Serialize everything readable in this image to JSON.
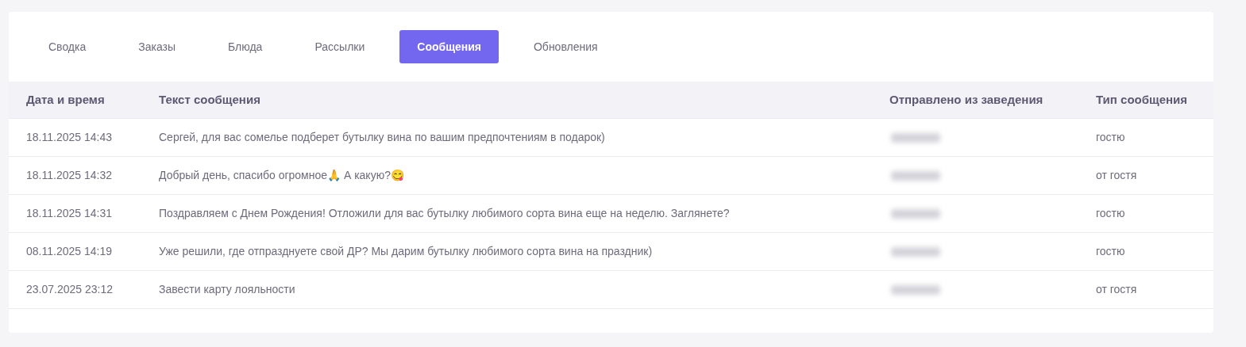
{
  "tabs": [
    {
      "label": "Сводка",
      "selected": false
    },
    {
      "label": "Заказы",
      "selected": false
    },
    {
      "label": "Блюда",
      "selected": false
    },
    {
      "label": "Рассылки",
      "selected": false
    },
    {
      "label": "Сообщения",
      "selected": true
    },
    {
      "label": "Обновления",
      "selected": false
    }
  ],
  "table": {
    "columns": [
      "Дата и время",
      "Текст сообщения",
      "Отправлено из заведения",
      "Тип сообщения"
    ],
    "rows": [
      {
        "date": "18.11.2025 14:43",
        "text": "Сергей, для вас сомелье подберет бутылку вина по вашим предпочтениям в подарок)",
        "venue_redacted": true,
        "type": "гостю"
      },
      {
        "date": "18.11.2025 14:32",
        "text": "Добрый день, спасибо огромное🙏 А какую?😋",
        "venue_redacted": true,
        "type": "от гостя"
      },
      {
        "date": "18.11.2025 14:31",
        "text": "Поздравляем с Днем Рождения! Отложили для вас бутылку любимого сорта вина еще на неделю. Заглянете?",
        "venue_redacted": true,
        "type": "гостю"
      },
      {
        "date": "08.11.2025 14:19",
        "text": "Уже решили, где отпразднуете свой ДР? Мы дарим бутылку любимого сорта вина на праздник)",
        "venue_redacted": true,
        "type": "гостю"
      },
      {
        "date": "23.07.2025 23:12",
        "text": "Завести карту лояльности",
        "venue_redacted": true,
        "type": "от гостя"
      }
    ]
  }
}
